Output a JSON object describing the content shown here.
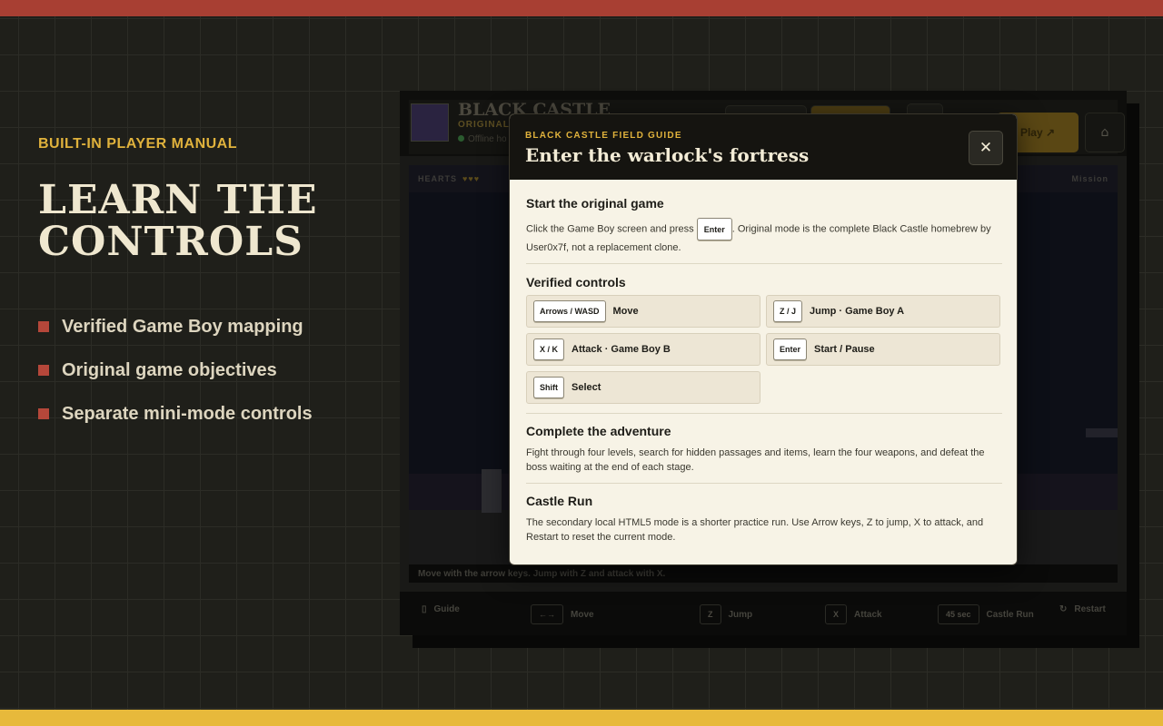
{
  "promo": {
    "eyebrow": "BUILT-IN PLAYER MANUAL",
    "title_line1": "LEARN THE",
    "title_line2": "CONTROLS",
    "items": [
      "Verified Game Boy mapping",
      "Original game objectives",
      "Separate mini-mode controls"
    ]
  },
  "app": {
    "name": "BLACK CASTLE",
    "mode": "ORIGINAL",
    "status": "Offline ho",
    "play_label": "Play ↗",
    "hud_hearts_label": "HEARTS",
    "hud_hearts": "♥♥♥",
    "hud_right": "Mission",
    "caption": "Move with the arrow keys. Jump with Z and attack with X.",
    "footer": {
      "guide": "Guide",
      "move_key": "←→",
      "move": "Move",
      "jump_key": "Z",
      "jump": "Jump",
      "attack_key": "X",
      "attack": "Attack",
      "timer": "45 sec",
      "castle_run": "Castle Run",
      "restart": "Restart"
    }
  },
  "modal": {
    "eyebrow": "BLACK CASTLE FIELD GUIDE",
    "title": "Enter the warlock's fortress",
    "close_symbol": "✕",
    "start": {
      "title": "Start the original game",
      "text_before": "Click the Game Boy screen and press",
      "key": "Enter",
      "text_after": ". Original mode is the complete Black Castle homebrew by",
      "text_line2": "User0x7f, not a replacement clone."
    },
    "controls": {
      "title": "Verified controls",
      "items": [
        {
          "key": "Arrows / WASD",
          "label": "Move"
        },
        {
          "key": "Z / J",
          "label": "Jump · Game Boy A"
        },
        {
          "key": "X / K",
          "label": "Attack · Game Boy B"
        },
        {
          "key": "Enter",
          "label": "Start / Pause"
        },
        {
          "key": "Shift",
          "label": "Select"
        }
      ]
    },
    "adventure": {
      "title": "Complete the adventure",
      "line1": "Fight through four levels, search for hidden passages and items, learn the four weapons, and defeat the",
      "line2": "boss waiting at the end of each stage."
    },
    "castle_run": {
      "title": "Castle Run",
      "line1": "The secondary local HTML5 mode is a shorter practice run. Use Arrow keys, Z to jump, X to attack, and",
      "line2": "Restart to reset the current mode."
    }
  },
  "colors": {
    "accent_red": "#a83f33",
    "accent_gold": "#e7b93b",
    "modal_bg": "#f7f3e6",
    "modal_header": "#151410"
  }
}
